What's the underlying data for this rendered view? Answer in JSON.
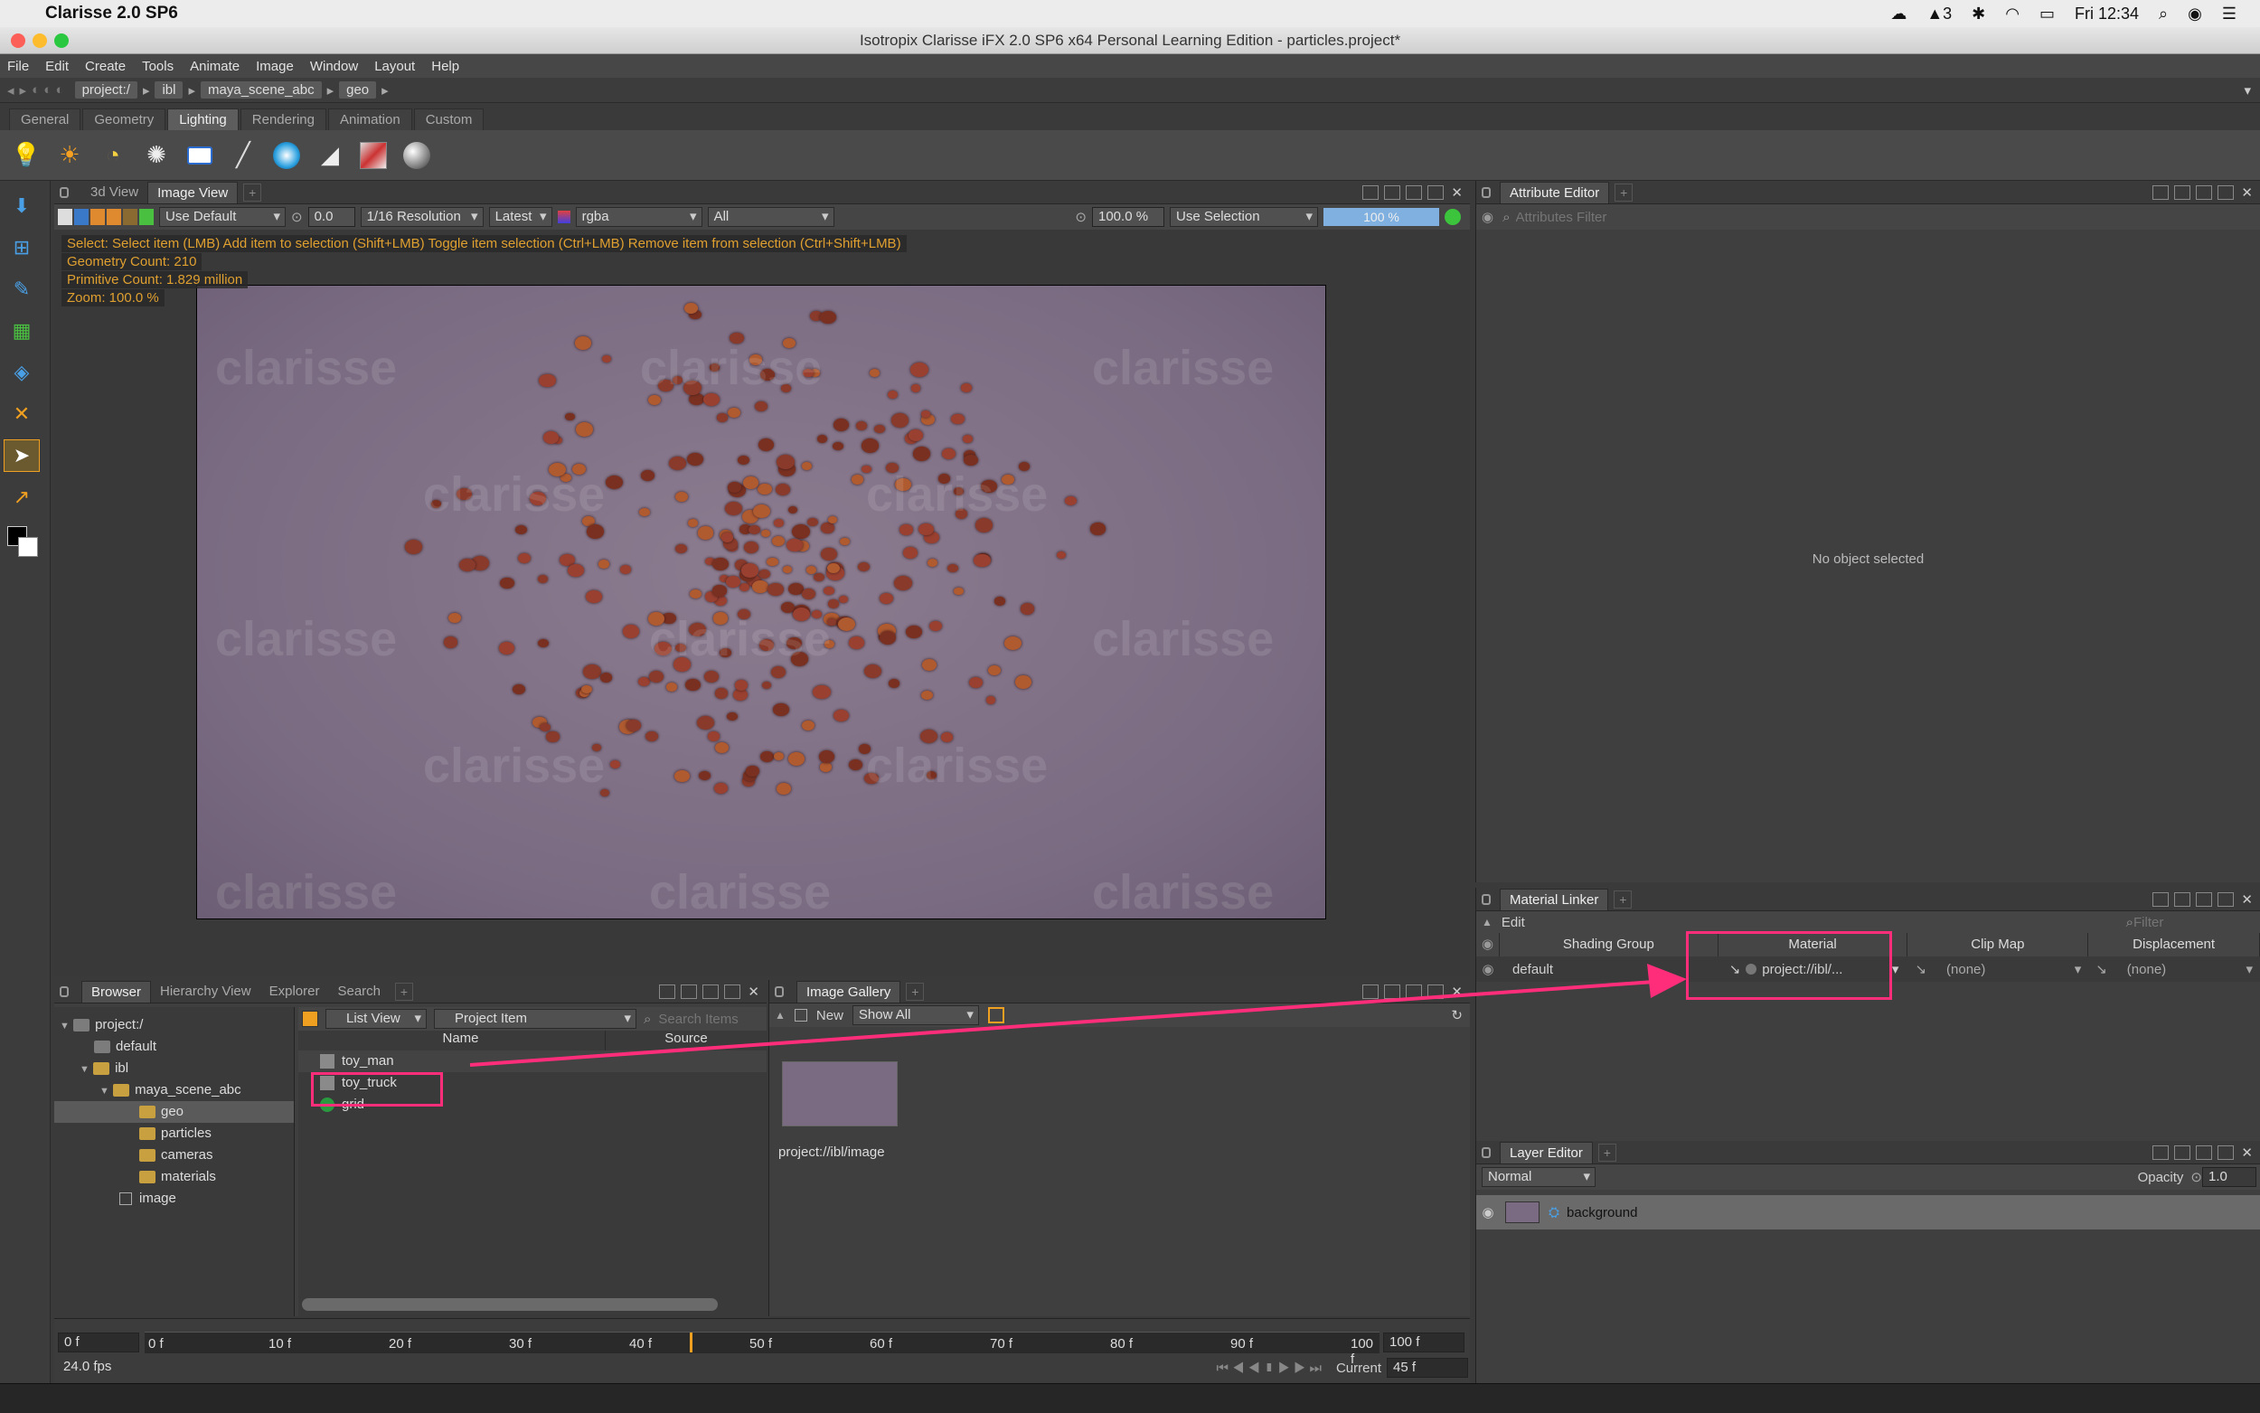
{
  "mac_menubar": {
    "app_name": "Clarisse 2.0 SP6",
    "status_items": [
      "3"
    ],
    "clock": "Fri 12:34"
  },
  "window": {
    "title": "Isotropix Clarisse iFX 2.0 SP6 x64 Personal Learning Edition - particles.project*"
  },
  "menu": [
    "File",
    "Edit",
    "Create",
    "Tools",
    "Animate",
    "Image",
    "Window",
    "Layout",
    "Help"
  ],
  "path": [
    "project:/",
    "ibl",
    "maya_scene_abc",
    "geo"
  ],
  "shelf_tabs": [
    "General",
    "Geometry",
    "Lighting",
    "Rendering",
    "Animation",
    "Custom"
  ],
  "shelf_active": "Lighting",
  "viewport": {
    "tabs": [
      "3d View",
      "Image View"
    ],
    "active_tab": "Image View",
    "use_default": "Use Default",
    "exposure": "0.0",
    "resolution": "1/16 Resolution",
    "latest": "Latest",
    "channel": "rgba",
    "layers": "All",
    "zoom": "100.0 %",
    "selection_mode": "Use Selection",
    "progress_label": "100 %",
    "progress": 1.0,
    "status_line": "Select: Select item (LMB)  Add item to selection (Shift+LMB)  Toggle item selection (Ctrl+LMB)  Remove item from selection (Ctrl+Shift+LMB)",
    "geometry_count": "Geometry Count: 210",
    "primitive_count": "Primitive Count: 1.829 million",
    "zoom_status": "Zoom: 100.0 %",
    "watermark": "clarisse"
  },
  "attribute_editor": {
    "tab": "Attribute Editor",
    "filter_placeholder": "Attributes Filter",
    "empty_message": "No object selected"
  },
  "material_linker": {
    "tab": "Material Linker",
    "edit_label": "Edit",
    "filter_placeholder": "Filter",
    "columns": [
      "Shading Group",
      "Material",
      "Clip Map",
      "Displacement"
    ],
    "row": {
      "group": "default",
      "material": "project://ibl/...",
      "clip_map": "(none)",
      "displacement": "(none)"
    }
  },
  "layer_editor": {
    "tab": "Layer Editor",
    "blend_mode": "Normal",
    "opacity_label": "Opacity",
    "opacity_value": "1.0",
    "layer_name": "background"
  },
  "browser": {
    "tabs": [
      "Browser",
      "Hierarchy View",
      "Explorer",
      "Search"
    ],
    "active_tab": "Browser",
    "view_mode": "List View",
    "item_type": "Project Item",
    "search_placeholder": "Search Items",
    "col_name": "Name",
    "col_source": "Source",
    "tree": [
      {
        "label": "project:/",
        "depth": 0,
        "type": "grey"
      },
      {
        "label": "default",
        "depth": 1,
        "type": "grey"
      },
      {
        "label": "ibl",
        "depth": 1,
        "type": "folder"
      },
      {
        "label": "maya_scene_abc",
        "depth": 2,
        "type": "folder"
      },
      {
        "label": "geo",
        "depth": 3,
        "type": "folder"
      },
      {
        "label": "particles",
        "depth": 3,
        "type": "folder"
      },
      {
        "label": "cameras",
        "depth": 3,
        "type": "folder"
      },
      {
        "label": "materials",
        "depth": 3,
        "type": "folder"
      },
      {
        "label": "image",
        "depth": 2,
        "type": "image"
      }
    ],
    "items": [
      "toy_man",
      "toy_truck",
      "grid"
    ]
  },
  "gallery": {
    "tab": "Image Gallery",
    "new_label": "New",
    "filter": "Show All",
    "image_label": "project://ibl/image"
  },
  "timeline": {
    "start": "0 f",
    "end": "100 f",
    "fps": "24.0 fps",
    "current_label": "Current",
    "current": "45 f",
    "ticks": [
      "0 f",
      "10 f",
      "20 f",
      "30 f",
      "40 f",
      "50 f",
      "60 f",
      "70 f",
      "80 f",
      "90 f",
      "100 f"
    ]
  },
  "colors": {
    "accent": "#ff2d7a",
    "progress": "#7fb0e0",
    "status_green": "#3cc43c"
  }
}
